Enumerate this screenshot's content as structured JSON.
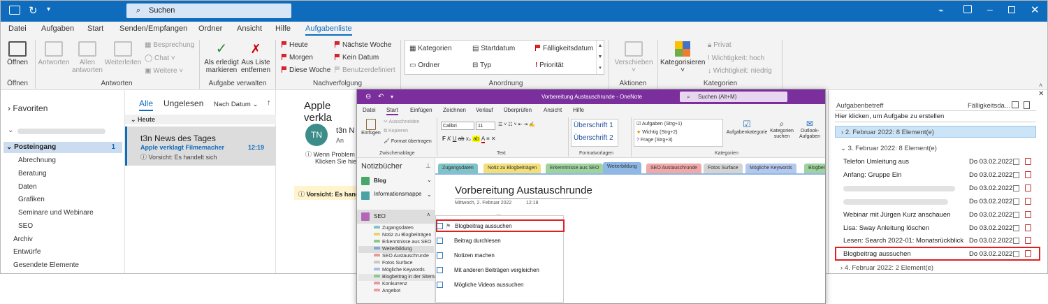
{
  "outlook": {
    "search_placeholder": "Suchen",
    "tabs": [
      "Datei",
      "Aufgaben",
      "Start",
      "Senden/Empfangen",
      "Ordner",
      "Ansicht",
      "Hilfe",
      "Aufgabenliste"
    ],
    "ribbon": {
      "open": "Öffnen",
      "reply": "Antworten",
      "reply_all": "Allen antworten",
      "forward": "Weiterleiten",
      "meeting": "Besprechung",
      "chat": "Chat",
      "more": "Weitere",
      "mark_done": "Als erledigt markieren",
      "remove_list": "Aus Liste entfernen",
      "today": "Heute",
      "tomorrow": "Morgen",
      "this_week": "Diese Woche",
      "next_week": "Nächste Woche",
      "no_date": "Kein Datum",
      "custom": "Benutzerdefiniert",
      "categories": "Kategorien",
      "start_date": "Startdatum",
      "due_date": "Fälligkeitsdatum",
      "folder": "Ordner",
      "type": "Typ",
      "priority": "Priorität",
      "move": "Verschieben",
      "categorize": "Kategorisieren",
      "private": "Privat",
      "high_importance": "Wichtigkeit: hoch",
      "low_importance": "Wichtigkeit: niedrig",
      "groups": [
        "Öffnen",
        "Antworten",
        "Aufgabe verwalten",
        "Nachverfolgung",
        "Anordnung",
        "Aktionen",
        "Kategorien"
      ]
    },
    "folders": {
      "favorites": "Favoriten",
      "inbox": "Posteingang",
      "inbox_count": "1",
      "items": [
        "Abrechnung",
        "Beratung",
        "Daten",
        "Grafiken",
        "Seminare und Webinare",
        "SEO"
      ],
      "archive": "Archiv",
      "drafts": "Entwürfe",
      "sent": "Gesendete Elemente"
    },
    "maillist": {
      "tab_all": "Alle",
      "tab_unread": "Ungelesen",
      "sort": "Nach Datum",
      "group_today": "Heute",
      "mail_sender": "t3n News des Tages",
      "mail_subject": "Apple verklagt Filmemacher",
      "mail_time": "12:19",
      "mail_preview": "Vorsicht: Es handelt sich"
    },
    "reading": {
      "subject": "Apple verkla",
      "avatar": "TN",
      "from": "t3n N",
      "to": "An",
      "info1": "Wenn Problem",
      "info2": "Klicken Sie hier",
      "warning": "Vorsicht: Es hand"
    },
    "tasks": {
      "col_subject": "Aufgabenbetreff",
      "col_due": "Fälligkeitsda...",
      "new_prompt": "Hier klicken, um Aufgabe zu erstellen",
      "group1": "2. Februar 2022: 8 Element(e)",
      "group2": "3. Februar 2022: 8 Element(e)",
      "group3": "4. Februar 2022: 2 Element(e)",
      "rows": [
        {
          "title": "Telefon Umleitung aus",
          "date": "Do 03.02.2022"
        },
        {
          "title": "Anfang: Gruppe Ein",
          "date": "Do 03.02.2022"
        },
        {
          "title": "",
          "date": "Do 03.02.2022"
        },
        {
          "title": "",
          "date": "Do 03.02.2022"
        },
        {
          "title": "Webinar mit Jürgen Kurz anschauen",
          "date": "Do 03.02.2022"
        },
        {
          "title": "Lisa: Sway Anleitung löschen",
          "date": "Do 03.02.2022"
        },
        {
          "title": "Lesen: Search 2022-01: Monatsrückblick",
          "date": "Do 03.02.2022"
        },
        {
          "title": "Blogbeitrag aussuchen",
          "date": "Do 03.02.2022"
        }
      ]
    }
  },
  "onenote": {
    "title": "Vorbereitung Austauschrunde  -  OneNote",
    "search": "Suchen (Alt+M)",
    "tabs": [
      "Datei",
      "Start",
      "Einfügen",
      "Zeichnen",
      "Verlauf",
      "Überprüfen",
      "Ansicht",
      "Hilfe"
    ],
    "ribbon": {
      "paste": "Einfügen",
      "cut": "Ausschneiden",
      "copy": "Kopieren",
      "format": "Format übertragen",
      "font": "Calibri",
      "size": "11",
      "heading1": "Überschrift 1",
      "heading2": "Überschrift 2",
      "tag1": "Aufgaben (Strg+1)",
      "tag2": "Wichtig (Strg+2)",
      "tag3": "Frage (Strg+3)",
      "task_category": "Aufgabenkategorie",
      "search_categories": "Kategorien suchen",
      "outlook_tasks": "Outlook-Aufgaben",
      "groups": [
        "Zwischenablage",
        "Text",
        "Formatvorlagen",
        "Kategorien"
      ]
    },
    "notebooks_label": "Notizbücher",
    "notebooks": [
      "Blog",
      "Informationsmappe",
      "SEO"
    ],
    "sections": [
      "Zugangsdaten",
      "Notiz zu Blogbeiträgen",
      "Erkenntnisse aus SEO",
      "Weiterbildung",
      "SEO Austauschrunde",
      "Fotos Surface",
      "Mögliche Keywords",
      "Blogbeitrag in der Sitema...",
      "Konkurrenz",
      "Angebot"
    ],
    "section_tabs": [
      "Zugangsdaten",
      "Notiz zu Blogbeiträgen",
      "Erkenntnisse aus SEO",
      "Weiterbildung",
      "SEO Austauschrunde",
      "Fotos Surface",
      "Mögliche Keywords",
      "Blogbeit"
    ],
    "page_title": "Vorbereitung Austauschrunde",
    "page_date": "Mittwoch, 2. Februar 2022",
    "page_time": "12:18",
    "todos": [
      "Blogbeitrag aussuchen",
      "Beitrag durchlesen",
      "Notizen machen",
      "Mit anderen Beiträgen vergleichen",
      "Mögliche Videos aussuchen"
    ]
  },
  "colors": {
    "outlook_blue": "#0f6cbd",
    "onenote_purple": "#7b2f9c",
    "highlight_red": "#e02020"
  }
}
